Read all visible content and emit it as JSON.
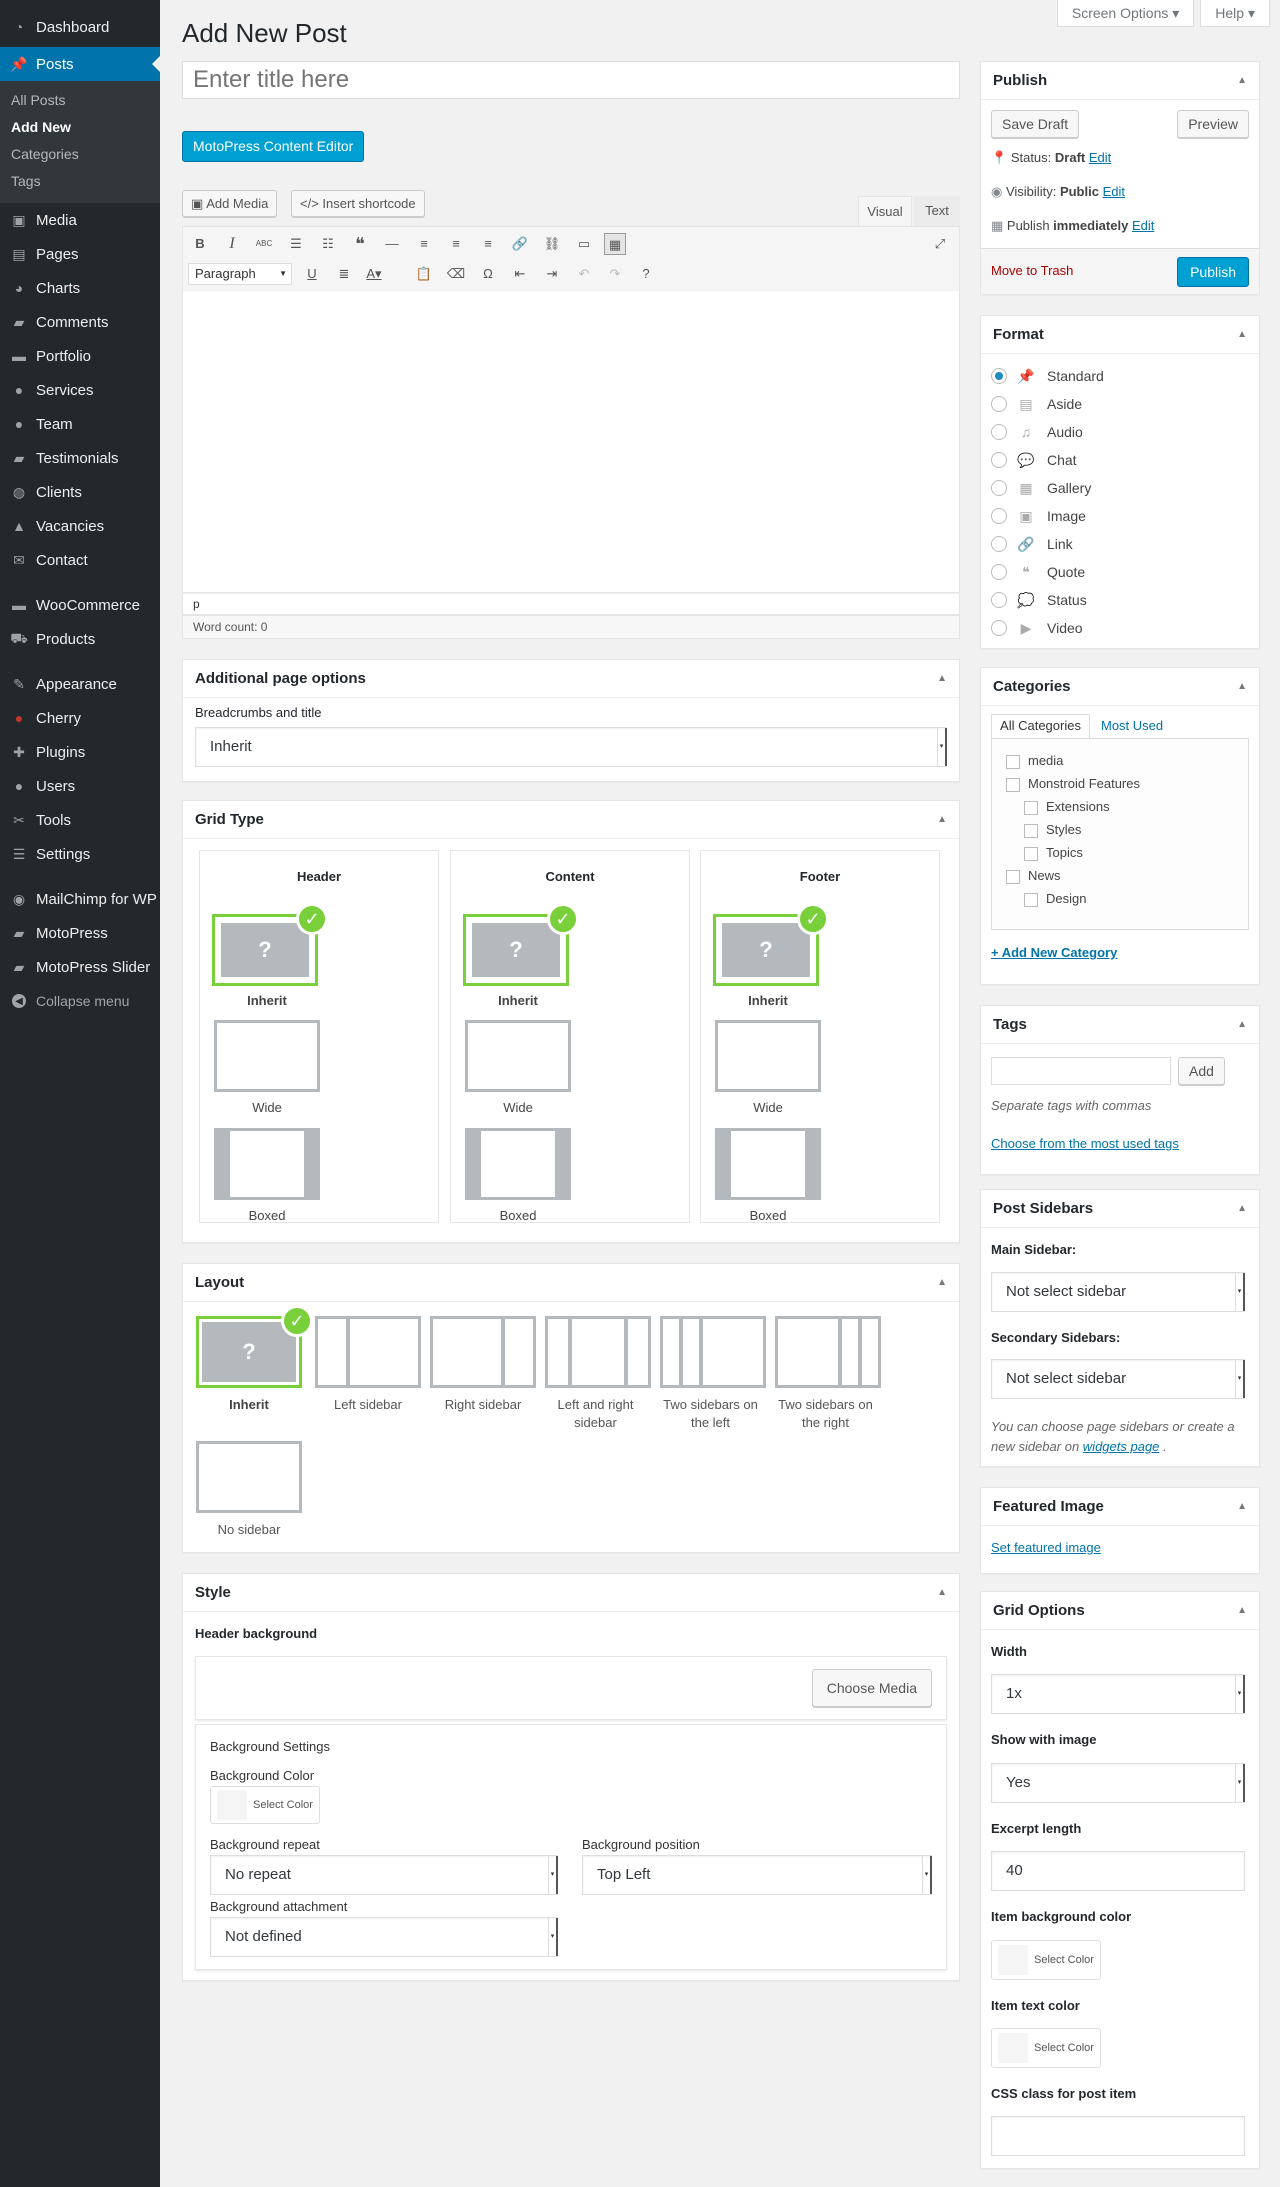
{
  "screen": {
    "options": "Screen Options ▾",
    "help": "Help ▾"
  },
  "menu": {
    "dashboard": "Dashboard",
    "posts": "Posts",
    "sub": [
      "All Posts",
      "Add New",
      "Categories",
      "Tags"
    ],
    "items": [
      "Media",
      "Pages",
      "Charts",
      "Comments",
      "Portfolio",
      "Services",
      "Team",
      "Testimonials",
      "Clients",
      "Vacancies",
      "Contact"
    ],
    "items2": [
      "WooCommerce",
      "Products"
    ],
    "items3": [
      "Appearance",
      "Cherry",
      "Plugins",
      "Users",
      "Tools",
      "Settings"
    ],
    "items4": [
      "MailChimp for WP",
      "MotoPress",
      "MotoPress Slider"
    ],
    "collapse": "Collapse menu"
  },
  "page": {
    "title": "Add New Post",
    "title_placeholder": "Enter title here",
    "mpce": "MotoPress Content Editor"
  },
  "editor": {
    "add_media": "Add Media",
    "insert_shortcode": "Insert shortcode",
    "tab_visual": "Visual",
    "tab_text": "Text",
    "format": "Paragraph",
    "path": "p",
    "word_count": "Word count: 0"
  },
  "additional": {
    "title": "Additional page options",
    "label": "Breadcrumbs and title",
    "value": "Inherit"
  },
  "grid": {
    "title": "Grid Type",
    "cols": [
      "Header",
      "Content",
      "Footer"
    ],
    "opts": [
      "Inherit",
      "Wide",
      "Boxed"
    ]
  },
  "layout": {
    "title": "Layout",
    "opts": [
      "Inherit",
      "Left sidebar",
      "Right sidebar",
      "Left and right sidebar",
      "Two sidebars on the left",
      "Two sidebars on the right",
      "No sidebar"
    ]
  },
  "style": {
    "title": "Style",
    "header_bg": "Header background",
    "choose_media": "Choose Media",
    "bg_settings": "Background Settings",
    "bg_color": "Background Color",
    "select_color": "Select Color",
    "bg_repeat": "Background repeat",
    "bg_repeat_val": "No repeat",
    "bg_position": "Background position",
    "bg_position_val": "Top Left",
    "bg_attach": "Background attachment",
    "bg_attach_val": "Not defined"
  },
  "publish": {
    "title": "Publish",
    "save_draft": "Save Draft",
    "preview": "Preview",
    "status_label": "Status:",
    "status": "Draft",
    "visibility_label": "Visibility:",
    "visibility": "Public",
    "publish_label": "Publish",
    "publish_when": "immediately",
    "edit": "Edit",
    "trash": "Move to Trash",
    "publish_btn": "Publish"
  },
  "format": {
    "title": "Format",
    "items": [
      "Standard",
      "Aside",
      "Audio",
      "Chat",
      "Gallery",
      "Image",
      "Link",
      "Quote",
      "Status",
      "Video"
    ],
    "icons": [
      "📌",
      "▤",
      "♫",
      "💬",
      "▦",
      "▣",
      "🔗",
      "❝",
      "💭",
      "▶"
    ]
  },
  "categories": {
    "title": "Categories",
    "tab_all": "All Categories",
    "tab_used": "Most Used",
    "items": [
      "media",
      "Monstroid Features",
      "Extensions",
      "Styles",
      "Topics",
      "News",
      "Design"
    ],
    "add": "+ Add New Category"
  },
  "tags": {
    "title": "Tags",
    "add": "Add",
    "hint": "Separate tags with commas",
    "choose": "Choose from the most used tags"
  },
  "sidebars": {
    "title": "Post Sidebars",
    "main": "Main Sidebar:",
    "main_val": "Not select sidebar",
    "secondary": "Secondary Sidebars:",
    "secondary_val": "Not select sidebar",
    "hint": "You can choose page sidebars or create a new sidebar on",
    "hint_link": "widgets page",
    "hint_end": "."
  },
  "featured": {
    "title": "Featured Image",
    "set": "Set featured image"
  },
  "gridopts": {
    "title": "Grid Options",
    "width": "Width",
    "width_val": "1x",
    "show": "Show with image",
    "show_val": "Yes",
    "excerpt": "Excerpt length",
    "excerpt_val": "40",
    "item_bg": "Item background color",
    "item_text": "Item text color",
    "select_color": "Select Color",
    "css": "CSS class for post item"
  }
}
